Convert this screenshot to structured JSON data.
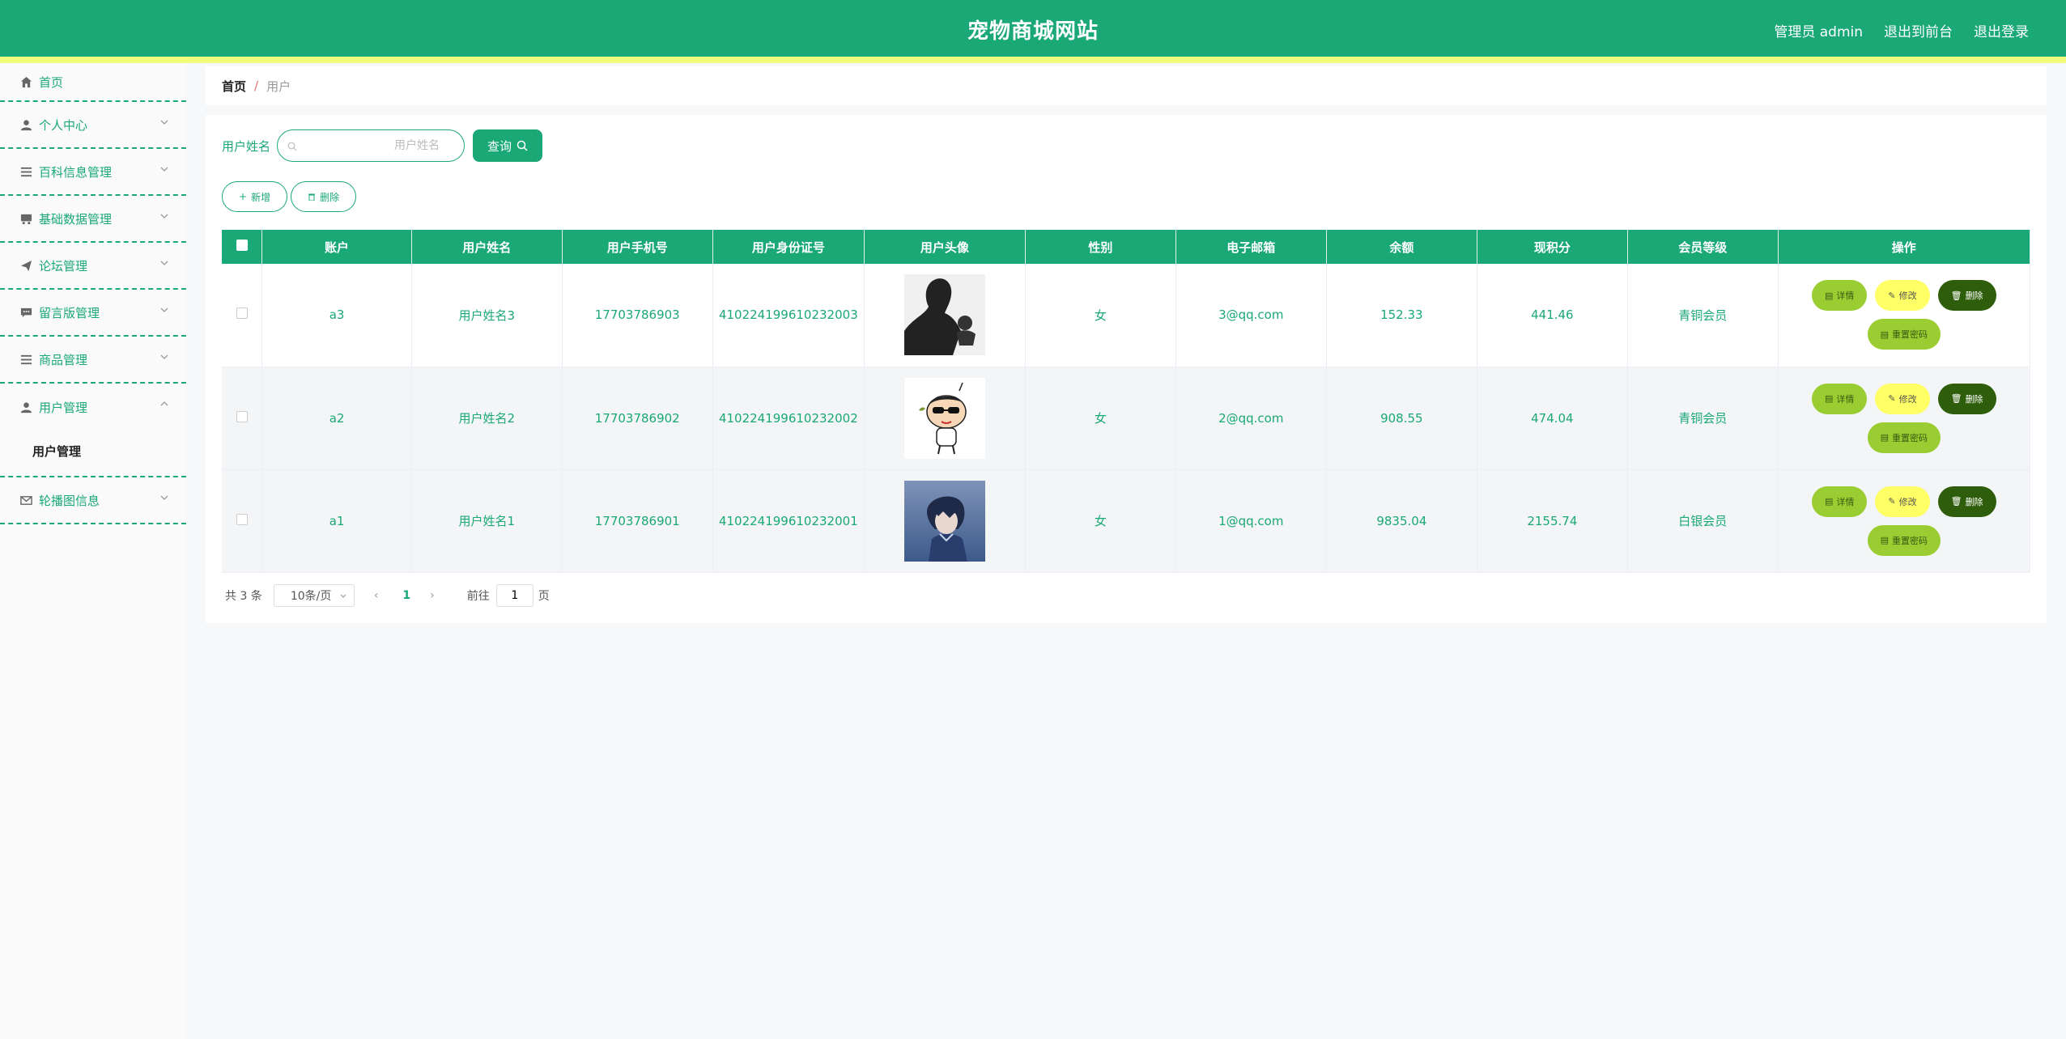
{
  "header": {
    "title": "宠物商城网站",
    "admin": "管理员 admin",
    "to_front": "退出到前台",
    "logout": "退出登录"
  },
  "sidebar": {
    "items": [
      {
        "label": "首页",
        "icon": "home-icon"
      },
      {
        "label": "个人中心",
        "icon": "user-icon"
      },
      {
        "label": "百科信息管理",
        "icon": "list-icon"
      },
      {
        "label": "基础数据管理",
        "icon": "database-icon"
      },
      {
        "label": "论坛管理",
        "icon": "send-icon"
      },
      {
        "label": "留言版管理",
        "icon": "chat-icon"
      },
      {
        "label": "商品管理",
        "icon": "list-icon"
      },
      {
        "label": "用户管理",
        "icon": "user-icon"
      },
      {
        "label": "轮播图信息",
        "icon": "mail-icon"
      }
    ],
    "sub_user_mgmt": "用户管理"
  },
  "breadcrumb": {
    "home": "首页",
    "separator": "/",
    "current": "用户"
  },
  "search": {
    "label": "用户姓名",
    "placeholder": "用户姓名",
    "button": "查询"
  },
  "actions": {
    "add": "新增",
    "delete": "删除"
  },
  "table": {
    "headers": [
      "账户",
      "用户姓名",
      "用户手机号",
      "用户身份证号",
      "用户头像",
      "性别",
      "电子邮箱",
      "余额",
      "现积分",
      "会员等级",
      "操作"
    ],
    "rows": [
      {
        "account": "a3",
        "name": "用户姓名3",
        "phone": "17703786903",
        "id_no": "410224199610232003",
        "avatar": "silhouette-man-avatar",
        "gender": "女",
        "email": "3@qq.com",
        "balance": "152.33",
        "points": "441.46",
        "level": "青铜会员"
      },
      {
        "account": "a2",
        "name": "用户姓名2",
        "phone": "17703786902",
        "id_no": "410224199610232002",
        "avatar": "cartoon-boy-avatar",
        "gender": "女",
        "email": "2@qq.com",
        "balance": "908.55",
        "points": "474.04",
        "level": "青铜会员"
      },
      {
        "account": "a1",
        "name": "用户姓名1",
        "phone": "17703786901",
        "id_no": "410224199610232001",
        "avatar": "anime-boy-avatar",
        "gender": "女",
        "email": "1@qq.com",
        "balance": "9835.04",
        "points": "2155.74",
        "level": "白银会员"
      }
    ],
    "op_labels": {
      "detail": "详情",
      "edit": "修改",
      "delete": "删除",
      "reset": "重置密码"
    }
  },
  "pagination": {
    "total": "共 3 条",
    "page_size": "10条/页",
    "current_page": "1",
    "goto_label": "前往",
    "goto_value": "1",
    "page_suffix": "页"
  },
  "colors": {
    "primary": "#1aa877",
    "stripe": "#f1fb7c",
    "detail": "#9acd32",
    "edit": "#ffff66",
    "delete": "#2e5e0b"
  }
}
